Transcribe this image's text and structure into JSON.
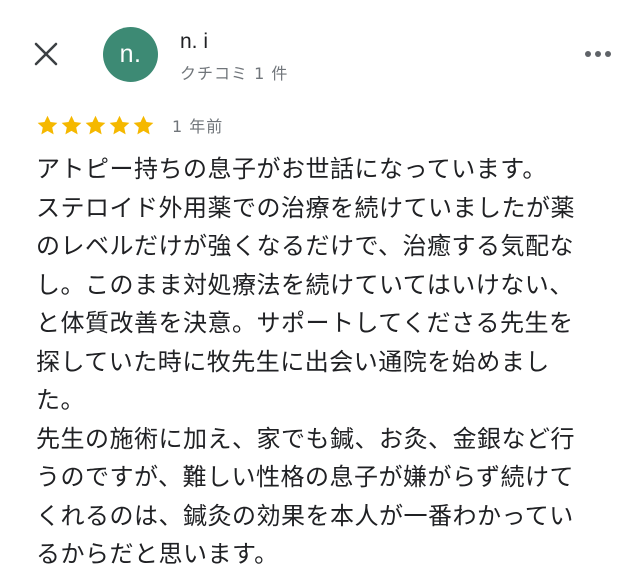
{
  "colors": {
    "avatar_bg": "#3d8a74",
    "star": "#f5b800",
    "text_primary": "#202124",
    "text_secondary": "#70757a"
  },
  "header": {
    "close_icon": "close-icon",
    "more_icon": "more-horizontal-icon"
  },
  "reviewer": {
    "avatar_text": "n.",
    "name": "n. i",
    "meta": "クチコミ 1 件"
  },
  "review": {
    "rating": 5,
    "max_rating": 5,
    "date": "1 年前",
    "lines": [
      "アトピー持ちの息子がお世話になっています。",
      "ステロイド外用薬での治療を続けていましたが薬",
      "のレベルだけが強くなるだけで、治癒する気配な",
      "し。このまま対処療法を続けていてはいけない、",
      "と体質改善を決意。サポートしてくださる先生を",
      "探していた時に牧先生に出会い通院を始めまし",
      "た。",
      "先生の施術に加え、家でも鍼、お灸、金銀など行",
      "うのですが、難しい性格の息子が嫌がらず続けて",
      "くれるのは、鍼灸の効果を本人が一番わかってい",
      "るからだと思います。"
    ]
  }
}
